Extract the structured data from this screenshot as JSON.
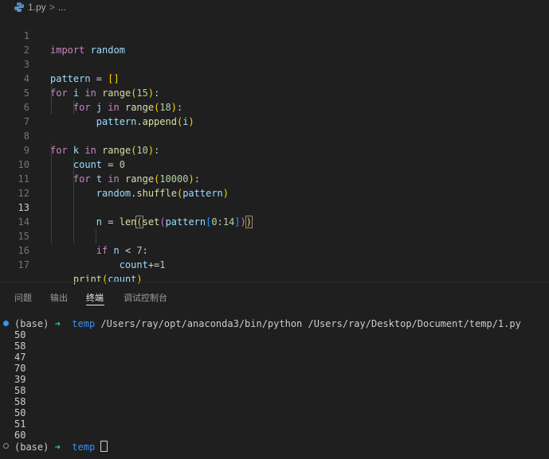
{
  "breadcrumb": {
    "file": "1.py",
    "sep": ">",
    "more": "..."
  },
  "editor": {
    "line_numbers": [
      "1",
      "2",
      "3",
      "4",
      "5",
      "6",
      "7",
      "8",
      "9",
      "10",
      "11",
      "12",
      "13",
      "14",
      "15",
      "16",
      "17"
    ],
    "current_line": "13"
  },
  "panel": {
    "tabs": [
      "问题",
      "输出",
      "终端",
      "调试控制台"
    ],
    "active_tab": "终端"
  },
  "terminal": {
    "env": "(base)",
    "arrow": "➜",
    "dir": "temp",
    "command": "/Users/ray/opt/anaconda3/bin/python /Users/ray/Desktop/Document/temp/1.py",
    "outputs": [
      "50",
      "58",
      "47",
      "70",
      "39",
      "58",
      "58",
      "50",
      "51",
      "60"
    ]
  }
}
